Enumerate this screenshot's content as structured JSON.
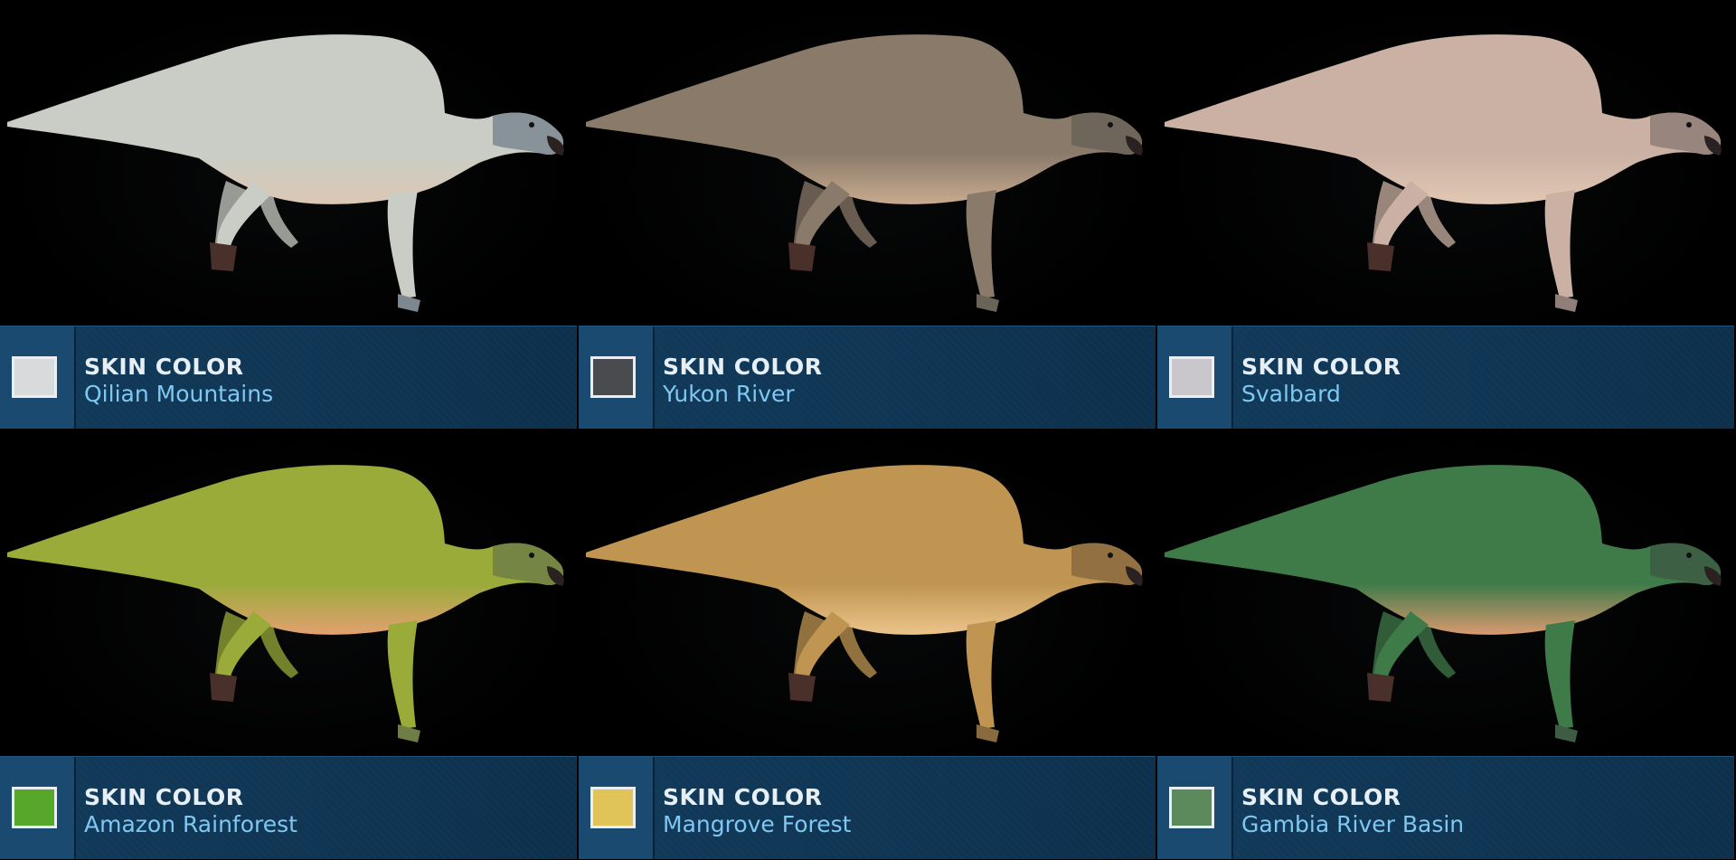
{
  "panels": [
    {
      "title": "SKIN COLOR",
      "name": "Qilian Mountains",
      "swatch_color": "#d9dadb",
      "body_color": "#c9cdc5",
      "belly_color": "#dcc7b4",
      "head_color": "#7c8790"
    },
    {
      "title": "SKIN COLOR",
      "name": "Yukon River",
      "swatch_color": "#4a4b4e",
      "body_color": "#8a7a6a",
      "belly_color": "#c8ab8f",
      "head_color": "#6a6358"
    },
    {
      "title": "SKIN COLOR",
      "name": "Svalbard",
      "swatch_color": "#c9c7cb",
      "body_color": "#cbb1a3",
      "belly_color": "#e1c8b4",
      "head_color": "#8f7f78"
    },
    {
      "title": "SKIN COLOR",
      "name": "Amazon Rainforest",
      "swatch_color": "#56a72a",
      "body_color": "#9aab3a",
      "belly_color": "#e3a070",
      "head_color": "#6f7e47"
    },
    {
      "title": "SKIN COLOR",
      "name": "Mangrove Forest",
      "swatch_color": "#e0c45a",
      "body_color": "#c09552",
      "belly_color": "#ebc48a",
      "head_color": "#8a6a3f"
    },
    {
      "title": "SKIN COLOR",
      "name": "Gambia River Basin",
      "swatch_color": "#5c8a5c",
      "body_color": "#3f7a49",
      "belly_color": "#d99a70",
      "head_color": "#3d5c43"
    }
  ]
}
